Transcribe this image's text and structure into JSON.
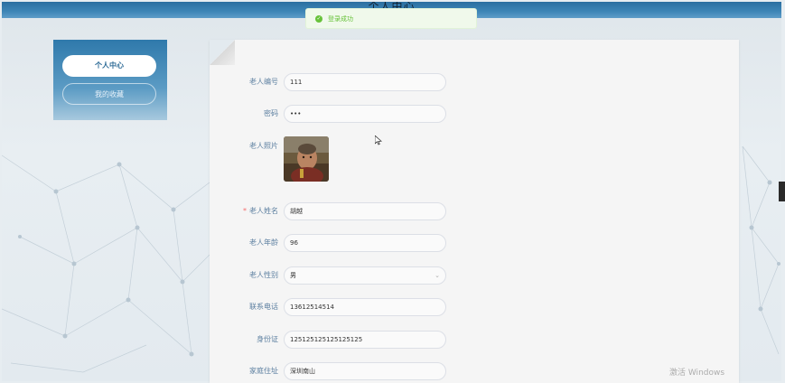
{
  "header": {
    "title": "个人中心"
  },
  "toast": {
    "message": "登录成功",
    "icon": "success-check-icon",
    "color": "#67c23a"
  },
  "sidebar": {
    "items": [
      {
        "label": "个人中心",
        "active": true
      },
      {
        "label": "我的收藏",
        "active": false
      }
    ]
  },
  "form": {
    "fields": {
      "elder_id": {
        "label": "老人编号",
        "value": "111"
      },
      "password": {
        "label": "密码",
        "value": "•••"
      },
      "photo": {
        "label": "老人照片"
      },
      "name": {
        "label": "老人姓名",
        "value": "胡越",
        "required": true
      },
      "age": {
        "label": "老人年龄",
        "value": "96"
      },
      "gender": {
        "label": "老人性别",
        "value": "男"
      },
      "phone": {
        "label": "联系电话",
        "value": "13612514514"
      },
      "id_card": {
        "label": "身份证",
        "value": "125125125125125125"
      },
      "address": {
        "label": "家庭住址",
        "value": "深圳南山"
      }
    }
  },
  "watermark": {
    "text": "激活 Windows"
  },
  "colors": {
    "accent": "#2d6b96",
    "label": "#5c7fa0",
    "required": "#f56c6c"
  }
}
